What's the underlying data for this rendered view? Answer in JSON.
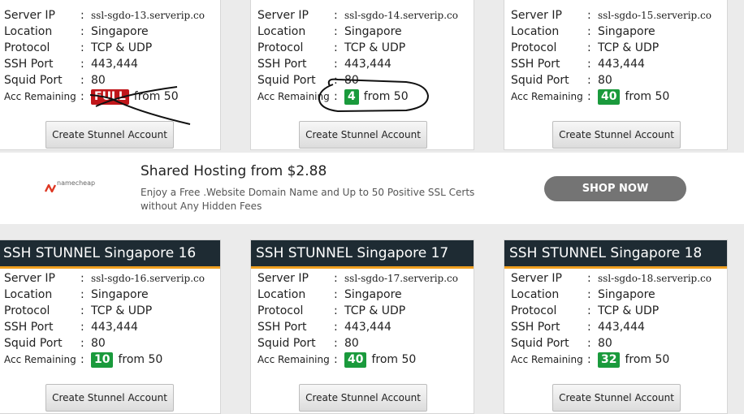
{
  "ad": {
    "brand": "namecheap",
    "title": "Shared Hosting from $2.88",
    "description": "Enjoy a Free .Website Domain Name and Up to 50 Positive SSL Certs without Any Hidden Fees",
    "button": "SHOP NOW",
    "brand_color": "#de3723"
  },
  "labels": {
    "server_ip": "Server IP",
    "location": "Location",
    "protocol": "Protocol",
    "ssh_port": "SSH Port",
    "squid_port": "Squid Port",
    "acc_remaining": "Acc Remaining",
    "colon": ":",
    "from": "from 50",
    "button": "Create Stunnel Account"
  },
  "servers": [
    {
      "title": "",
      "host": "ssl-sgdo-13.serverip.co",
      "location": "Singapore",
      "protocol": "TCP & UDP",
      "ssh_port": "443,444",
      "squid_port": "80",
      "remaining": "FULL",
      "status": "full"
    },
    {
      "title": "",
      "host": "ssl-sgdo-14.serverip.co",
      "location": "Singapore",
      "protocol": "TCP & UDP",
      "ssh_port": "443,444",
      "squid_port": "80",
      "remaining": "4",
      "status": "available"
    },
    {
      "title": "",
      "host": "ssl-sgdo-15.serverip.co",
      "location": "Singapore",
      "protocol": "TCP & UDP",
      "ssh_port": "443,444",
      "squid_port": "80",
      "remaining": "40",
      "status": "available"
    },
    {
      "title": "SSH STUNNEL Singapore 16",
      "host": "ssl-sgdo-16.serverip.co",
      "location": "Singapore",
      "protocol": "TCP & UDP",
      "ssh_port": "443,444",
      "squid_port": "80",
      "remaining": "10",
      "status": "available"
    },
    {
      "title": "SSH STUNNEL Singapore 17",
      "host": "ssl-sgdo-17.serverip.co",
      "location": "Singapore",
      "protocol": "TCP & UDP",
      "ssh_port": "443,444",
      "squid_port": "80",
      "remaining": "40",
      "status": "available"
    },
    {
      "title": "SSH STUNNEL Singapore 18",
      "host": "ssl-sgdo-18.serverip.co",
      "location": "Singapore",
      "protocol": "TCP & UDP",
      "ssh_port": "443,444",
      "squid_port": "80",
      "remaining": "32",
      "status": "available"
    }
  ],
  "colors": {
    "header_bg": "#1e2b33",
    "header_accent": "#f0a020",
    "badge_available": "#1a9a3c",
    "badge_full": "#c0161a"
  }
}
